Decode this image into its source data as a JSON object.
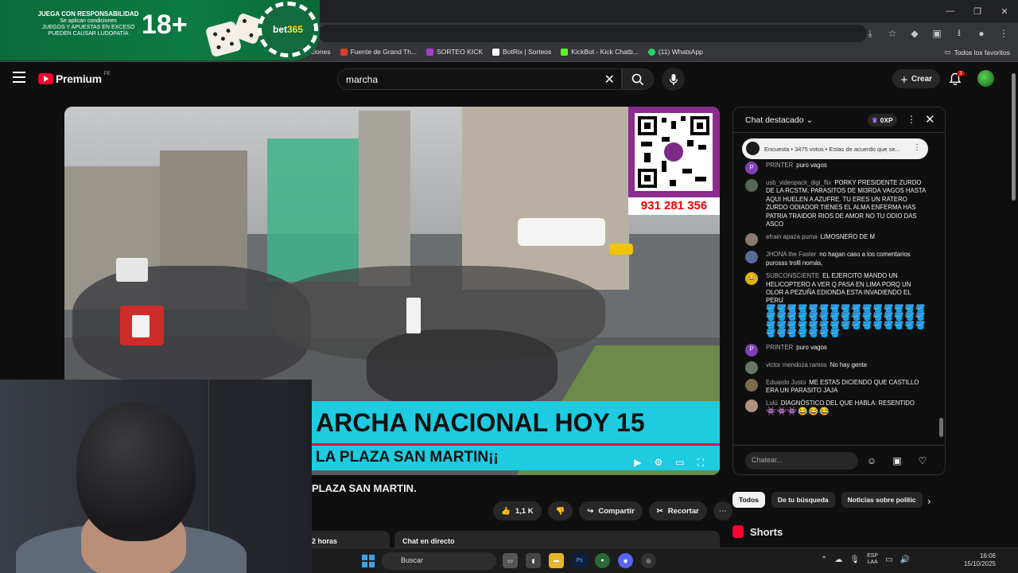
{
  "browser": {
    "window_controls": [
      "—",
      "❐",
      "✕"
    ],
    "bookmarks": [
      {
        "label": "ciones",
        "color": "#888888"
      },
      {
        "label": "Fuente de Grand Th...",
        "color": "#d9402b"
      },
      {
        "label": "SORTEO KICK",
        "color": "#a540c8"
      },
      {
        "label": "BotRix | Sorteos",
        "color": "#ffffff"
      },
      {
        "label": "KickBot - Kick Chatb...",
        "color": "#53fc18"
      },
      {
        "label": "(11) WhatsApp",
        "color": "#25d366"
      }
    ],
    "all_favorites": "Todos los favoritos"
  },
  "banner": {
    "headline": "JUEGA CON RESPONSABILIDAD",
    "line2": "Se aplican condiciones",
    "line3": "JUEGOS Y APUESTAS EN EXCESO",
    "line4": "PUEDEN CAUSAR LUDOPATÍA",
    "age": "18+",
    "brand_a": "bet",
    "brand_b": "365"
  },
  "youtube": {
    "logo": "Premium",
    "country": "PE",
    "search_value": "marcha",
    "create_label": "Crear",
    "notif_count": "3"
  },
  "video": {
    "phone": "931 281 356",
    "overlay_title": "ARCHA NACIONAL HOY 15",
    "overlay_sub": "LA PLAZA SAN MARTIN¡¡",
    "title": "PLAZA SAN MARTIN.",
    "likes": "1,1 K",
    "share": "Compartir",
    "clip": "Recortar",
    "desc_time": "2 horas",
    "live_chat": "Chat en directo"
  },
  "chat": {
    "title": "Chat destacado",
    "xp": "0XP",
    "poll": "Encuesta • 3475 votos • Estas de acuerdo que se...",
    "input_placeholder": "Chatear...",
    "messages": [
      {
        "author": "PRINTER",
        "text": "puro vagos",
        "avatar": "P",
        "color": "#7e3fb5"
      },
      {
        "author": "usb_videopack_digi_flix",
        "text": "PORKY PRESIDENTE ZURDO DE LA RCSTM, PARASITOS DE MI3RDA VAGOS HASTA AQUI HUELEN A AZUFRE. TU ERES UN RATERO ZURDO ODIADOR TIENES EL ALMA ENFERMA HAS PATRIA TRAIDOR RIOS DE AMOR NO TU ODIO DAS ASCO",
        "avatar": "",
        "color": "#556655"
      },
      {
        "author": "efrain apaza puma",
        "text": "LIMOSNERO DE M",
        "avatar": "",
        "color": "#8a7a70"
      },
      {
        "author": "JHONA the Faster",
        "text": "no hagan caso a los comentarios purosss trolll nomás,",
        "avatar": "",
        "color": "#5a6a9a"
      },
      {
        "author": "SUBCONSCIENTE",
        "text": "EL EJERCITO MANDO UN HELICOPTERO A VER Q PASA EN LIMA PORQ UN OLOR A PEZUÑA EDIONDA ESTA INVADIENDO EL PERU",
        "avatar": "😂",
        "color": "#e8b100"
      },
      {
        "author": "PRINTER",
        "text": "puro vagos",
        "avatar": "P",
        "color": "#7e3fb5"
      },
      {
        "author": "victor mendoza ramos",
        "text": "No hay gente",
        "avatar": "",
        "color": "#667766"
      },
      {
        "author": "Eduardo Justo",
        "text": "ME ESTAS DICIENDO QUE CASTILLO ERA UN PARASITO JAJA",
        "avatar": "",
        "color": "#7a6a50"
      },
      {
        "author": "Lulú",
        "text": "DIAGNÓSTICO DEL QUE HABLA: RESENTIDO",
        "avatar": "",
        "color": "#b09080"
      }
    ],
    "bucket_emojis": "🪣🪣🪣🪣🪣🪣🪣🪣🪣🪣🪣🪣🪣🪣🪣🪣🪣🪣🪣🪣🪣🪣🪣🪣🪣🪣🪣🪣🪣🪣🪣🪣🪣🪣🪣🪣🪣🪣🪣🪣🪣🪣🪣🪣🪣🪣🪣🪣🪣🪣🪣🪣",
    "last_emojis": "👾👾👾😂😂😂"
  },
  "filters": {
    "chips": [
      "Todos",
      "De tu búsqueda",
      "Noticias sobre polític"
    ],
    "shorts": "Shorts"
  },
  "taskbar": {
    "search": "Buscar",
    "lang_top": "ESP",
    "lang_bottom": "LAA",
    "time": "16:06",
    "date": "15/10/2025"
  }
}
